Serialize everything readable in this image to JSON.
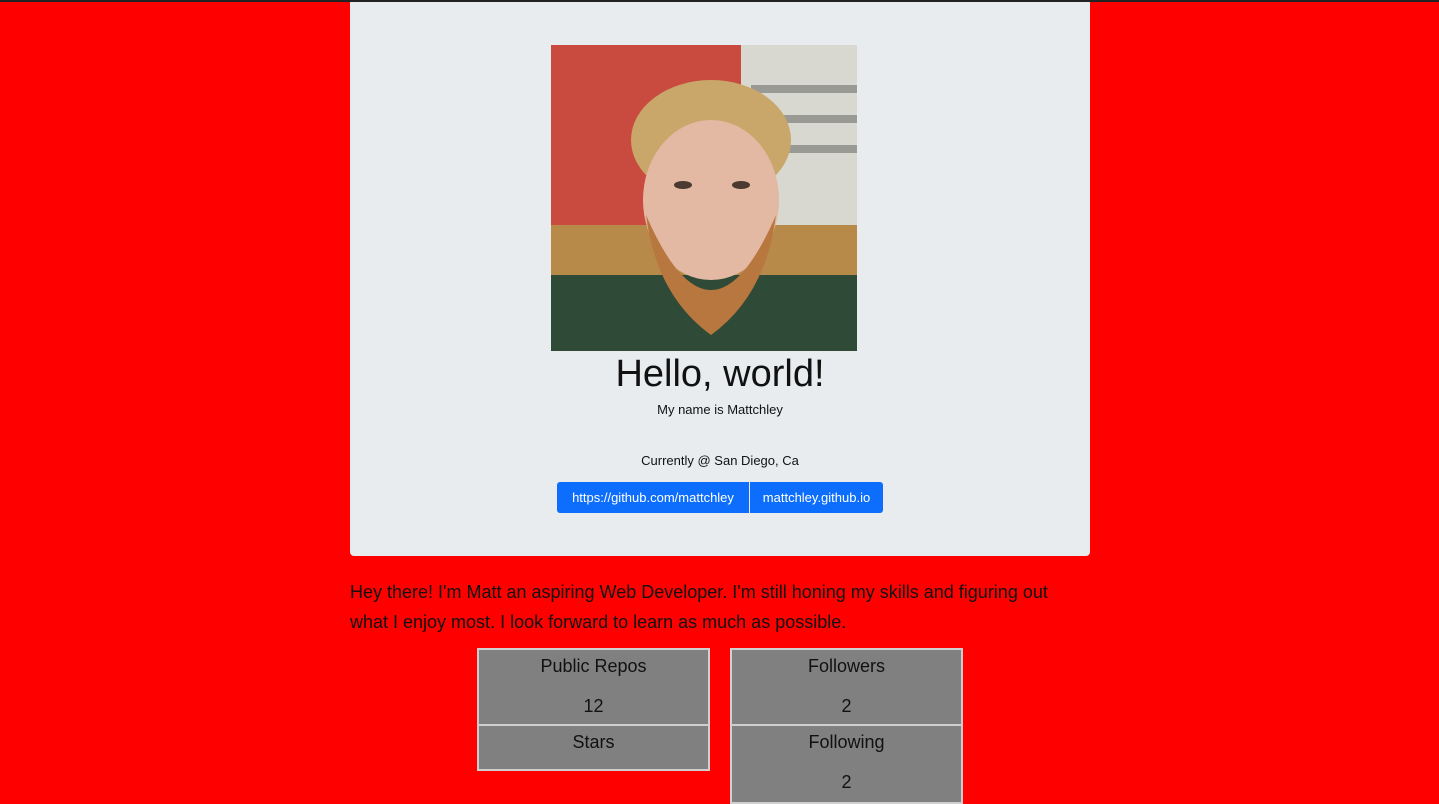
{
  "profile": {
    "headline": "Hello, world!",
    "name_line": "My name is Mattchley",
    "location": "Currently @ San Diego, Ca",
    "github_link": "https://github.com/mattchley",
    "site_link": "mattchley.github.io"
  },
  "intro": "Hey there! I'm Matt an aspiring Web Developer. I'm still honing my skills and figuring out what I enjoy most. I look forward to learn as much as possible.",
  "stats": {
    "repos": {
      "label": "Public Repos",
      "value": "12"
    },
    "followers": {
      "label": "Followers",
      "value": "2"
    },
    "stars": {
      "label": "Stars",
      "value": ""
    },
    "following": {
      "label": "Following",
      "value": "2"
    }
  },
  "colors": {
    "background": "#ff0000",
    "card": "#e9ecef",
    "button": "#0d6efd",
    "stat_box": "#808080"
  }
}
